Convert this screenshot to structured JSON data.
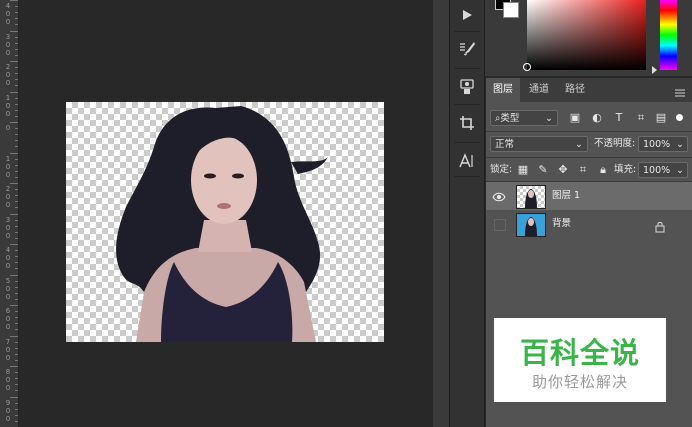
{
  "ruler": {
    "labels": [
      "4\n0\n0",
      "3\n0\n0",
      "2\n0\n0",
      "1\n0\n0",
      "0",
      "1\n0\n0",
      "2\n0\n0",
      "3\n0\n0",
      "4\n0\n0",
      "5\n0\n0",
      "6\n0\n0",
      "7\n0\n0",
      "8\n0\n0",
      "9\n0\n0"
    ]
  },
  "colors": {
    "foreground": "#000000",
    "background": "#ffffff",
    "accent": "#e8201c"
  },
  "tools": [
    {
      "icon": "play-icon"
    },
    {
      "icon": "brush-settings-icon"
    },
    {
      "icon": "clone-source-icon"
    },
    {
      "icon": "crop-icon"
    },
    {
      "icon": "character-icon"
    }
  ],
  "layers_panel": {
    "tabs": [
      "图层",
      "通道",
      "路径"
    ],
    "active_tab": "图层",
    "filter_kind": "类型",
    "blend_mode": "正常",
    "opacity_label": "不透明度:",
    "opacity_value": "100%",
    "lock_label": "锁定:",
    "fill_label": "填充:",
    "fill_value": "100%",
    "layers": [
      {
        "name": "图层 1",
        "visible": true,
        "selected": true,
        "locked": false
      },
      {
        "name": "背景",
        "visible": false,
        "selected": false,
        "locked": true
      }
    ]
  },
  "watermark": {
    "title": "百科全说",
    "subtitle": "助你轻松解决"
  }
}
